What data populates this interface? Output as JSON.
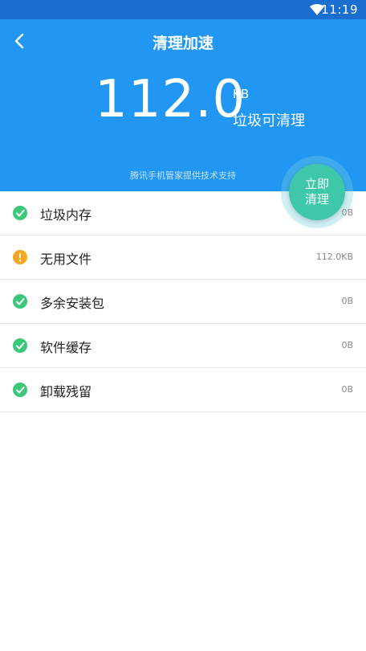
{
  "status_bar": {
    "time": "11:19",
    "wifi_icon": "wifi-icon"
  },
  "header": {
    "title": "清理加速",
    "amount": "112.0",
    "unit": "KB",
    "caption": "垃圾可清理",
    "provider": "腾讯手机管家提供技术支持",
    "clean_button": {
      "line1": "立即",
      "line2": "清理"
    }
  },
  "colors": {
    "header_bg": "#2196f3",
    "status_bar_bg": "#1a6fce",
    "button_green": "#3ec7a8",
    "ok_green": "#3cc77a",
    "warning_orange": "#f5a623"
  },
  "items": [
    {
      "label": "垃圾内存",
      "size": "0B",
      "status": "ok"
    },
    {
      "label": "无用文件",
      "size": "112.0KB",
      "status": "warning"
    },
    {
      "label": "多余安装包",
      "size": "0B",
      "status": "ok"
    },
    {
      "label": "软件缓存",
      "size": "0B",
      "status": "ok"
    },
    {
      "label": "卸载残留",
      "size": "0B",
      "status": "ok"
    }
  ]
}
